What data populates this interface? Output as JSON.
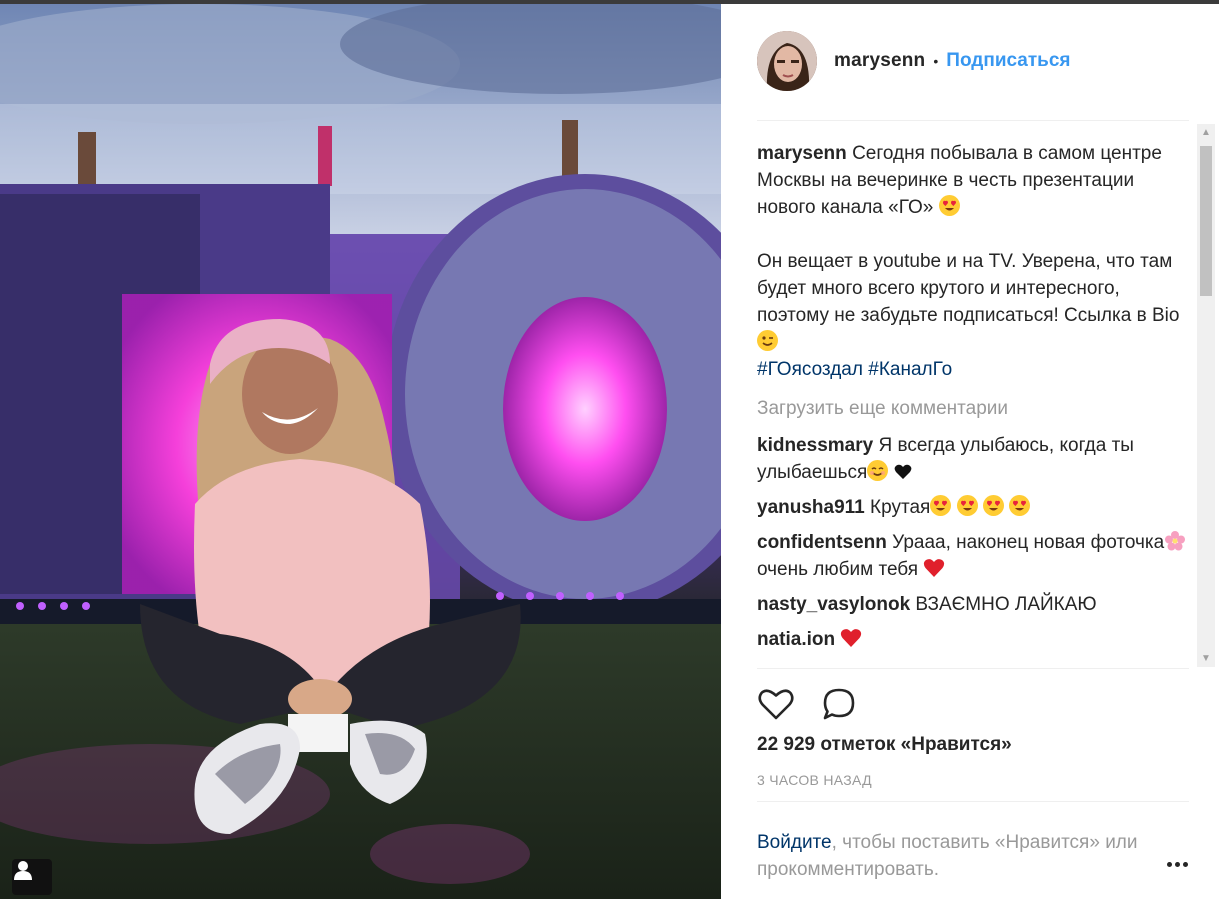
{
  "post": {
    "username": "marysenn",
    "separator": "•",
    "follow_label": "Подписаться",
    "caption": {
      "username": "marysenn",
      "text_1": "Сегодня побывала в самом центре Москвы на вечеринке в честь презентации нового канала «ГО»",
      "text_2": "Он вещает в youtube и на TV. Уверена, что там будет много всего крутого и интересного, поэтому не забудьте подписаться! Ссылка в Bio",
      "hashtag_1": "#ГОясоздал",
      "hashtag_2": "#КаналГо"
    },
    "load_more_label": "Загрузить еще комментарии",
    "comments": [
      {
        "username": "kidnessmary",
        "text": "Я всегда улыбаюсь, когда ты улыбаешься"
      },
      {
        "username": "yanusha911",
        "text": "Крутая"
      },
      {
        "username": "confidentsenn",
        "text_1": "Урааа, наконец новая фоточка",
        "text_2": "очень любим тебя"
      },
      {
        "username": "nasty_vasylonok",
        "text": "ВЗАЄМНО ЛАЙКАЮ"
      },
      {
        "username": "natia.ion",
        "text": ""
      }
    ],
    "likes_text": "22 929 отметок «Нравится»",
    "time_text": "3 ЧАСОВ НАЗАД",
    "login": {
      "link_label": "Войдите",
      "rest_text": ", чтобы поставить «Нравится» или прокомментировать."
    }
  },
  "icons": {
    "heart": "heart-outline-icon",
    "comment": "comment-bubble-icon",
    "more": "more-options-icon",
    "user_tag": "user-tag-icon"
  },
  "colors": {
    "link_blue": "#3897f0",
    "hashtag": "#003569",
    "muted": "#999999",
    "text": "#262626"
  }
}
